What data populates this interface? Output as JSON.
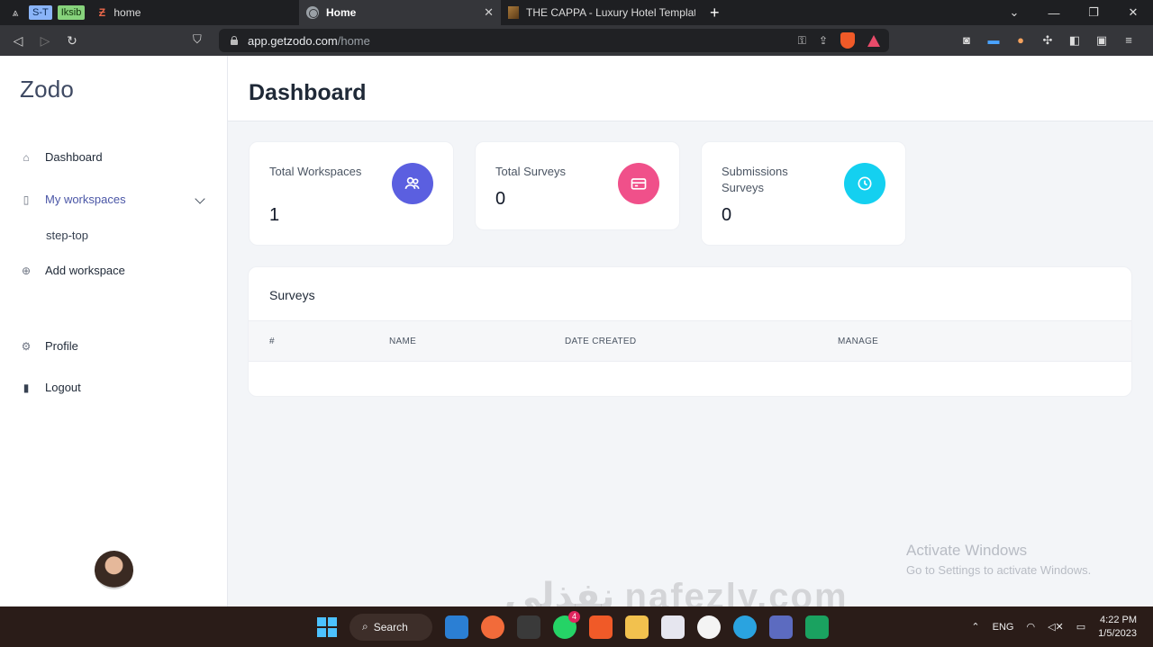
{
  "browser": {
    "tab_pills": [
      "S-T",
      "Iksib"
    ],
    "tabs": [
      {
        "title": "home",
        "active": false
      },
      {
        "title": "Home",
        "active": true
      },
      {
        "title": "THE CAPPA - Luxury Hotel Template b",
        "active": false
      }
    ],
    "url_host": "app.getzodo.com",
    "url_path": "/home"
  },
  "sidebar": {
    "brand": "Zodo",
    "items": [
      {
        "label": "Dashboard",
        "icon": "home-icon"
      },
      {
        "label": "My workspaces",
        "icon": "clipboard-icon"
      },
      {
        "label": "step-top"
      },
      {
        "label": "Add workspace",
        "icon": "plus-circle-icon"
      },
      {
        "label": "Profile",
        "icon": "gear-icon"
      },
      {
        "label": "Logout",
        "icon": "door-icon"
      }
    ]
  },
  "header": {
    "title": "Dashboard"
  },
  "stats": [
    {
      "label": "Total Workspaces",
      "value": "1",
      "color": "#5b5fe0",
      "icon": "users-icon"
    },
    {
      "label": "Total Surveys",
      "value": "0",
      "color": "#f0508a",
      "icon": "card-icon"
    },
    {
      "label": "Submissions Surveys",
      "value": "0",
      "color": "#14d0f0",
      "icon": "clock-icon"
    }
  ],
  "surveys": {
    "title": "Surveys",
    "columns": [
      "#",
      "NAME",
      "DATE CREATED",
      "MANAGE"
    ]
  },
  "watermarks": {
    "activate_title": "Activate Windows",
    "activate_sub": "Go to Settings to activate Windows.",
    "site": "نفذلي nafezly.com"
  },
  "taskbar": {
    "search_label": "Search",
    "whatsapp_badge": "4",
    "lang": "ENG",
    "time": "4:22 PM",
    "date": "1/5/2023"
  }
}
